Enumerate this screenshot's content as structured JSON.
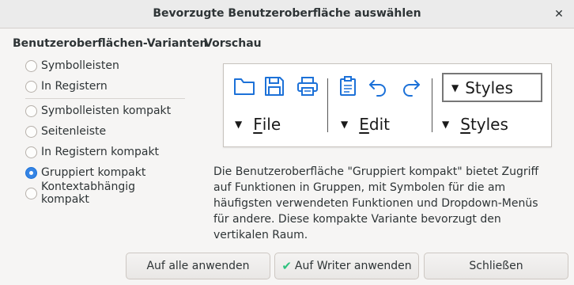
{
  "window": {
    "title": "Bevorzugte Benutzeroberfläche auswählen",
    "close_glyph": "✕"
  },
  "variants": {
    "heading": "Benutzeroberflächen-Varianten",
    "options": [
      {
        "label": "Symbolleisten",
        "checked": false
      },
      {
        "label": "In Registern",
        "checked": false
      },
      {
        "label": "Symbolleisten kompakt",
        "checked": false
      },
      {
        "label": "Seitenleiste",
        "checked": false
      },
      {
        "label": "In Registern kompakt",
        "checked": false
      },
      {
        "label": "Gruppiert kompakt",
        "checked": true
      },
      {
        "label": "Kontextabhängig kompakt",
        "checked": false
      }
    ]
  },
  "preview": {
    "heading": "Vorschau",
    "menus": [
      {
        "accel": "F",
        "rest": "ile"
      },
      {
        "accel": "E",
        "rest": "dit"
      },
      {
        "accel": "S",
        "rest": "tyles"
      }
    ],
    "styles_box": "Styles",
    "icons": [
      "folder-icon",
      "save-icon",
      "print-icon",
      "clipboard-icon",
      "undo-icon",
      "redo-icon"
    ],
    "icon_color": "#1c71d8"
  },
  "description": "Die Benutzeroberfläche \"Gruppiert kompakt\" bietet Zugriff auf Funktionen in Gruppen, mit Symbolen für die am häufigsten verwendeten Funktionen und Dropdown-Menüs für andere. Diese kompakte Variante bevorzugt den vertikalen Raum.",
  "buttons": {
    "apply_all": "Auf alle anwenden",
    "apply_writer": "Auf Writer anwenden",
    "close": "Schließen"
  },
  "colors": {
    "accent": "#3584e4",
    "check": "#2ec27e"
  }
}
